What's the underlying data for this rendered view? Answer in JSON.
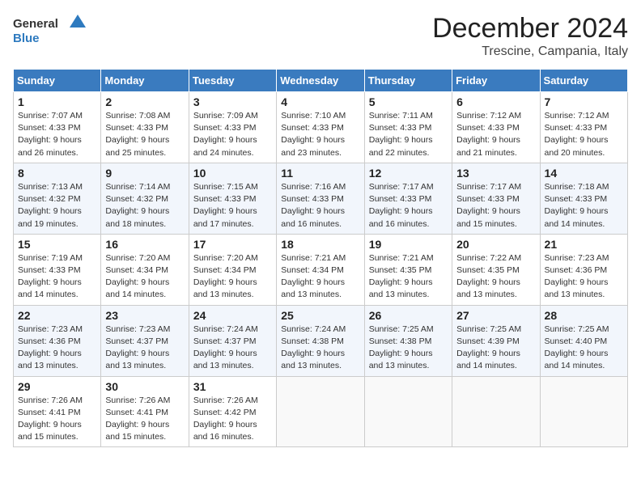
{
  "logo": {
    "text_general": "General",
    "text_blue": "Blue",
    "icon_color": "#2e7abf"
  },
  "header": {
    "month": "December 2024",
    "location": "Trescine, Campania, Italy"
  },
  "weekdays": [
    "Sunday",
    "Monday",
    "Tuesday",
    "Wednesday",
    "Thursday",
    "Friday",
    "Saturday"
  ],
  "weeks": [
    [
      {
        "day": "1",
        "sunrise": "7:07 AM",
        "sunset": "4:33 PM",
        "daylight": "9 hours and 26 minutes."
      },
      {
        "day": "2",
        "sunrise": "7:08 AM",
        "sunset": "4:33 PM",
        "daylight": "9 hours and 25 minutes."
      },
      {
        "day": "3",
        "sunrise": "7:09 AM",
        "sunset": "4:33 PM",
        "daylight": "9 hours and 24 minutes."
      },
      {
        "day": "4",
        "sunrise": "7:10 AM",
        "sunset": "4:33 PM",
        "daylight": "9 hours and 23 minutes."
      },
      {
        "day": "5",
        "sunrise": "7:11 AM",
        "sunset": "4:33 PM",
        "daylight": "9 hours and 22 minutes."
      },
      {
        "day": "6",
        "sunrise": "7:12 AM",
        "sunset": "4:33 PM",
        "daylight": "9 hours and 21 minutes."
      },
      {
        "day": "7",
        "sunrise": "7:12 AM",
        "sunset": "4:33 PM",
        "daylight": "9 hours and 20 minutes."
      }
    ],
    [
      {
        "day": "8",
        "sunrise": "7:13 AM",
        "sunset": "4:32 PM",
        "daylight": "9 hours and 19 minutes."
      },
      {
        "day": "9",
        "sunrise": "7:14 AM",
        "sunset": "4:32 PM",
        "daylight": "9 hours and 18 minutes."
      },
      {
        "day": "10",
        "sunrise": "7:15 AM",
        "sunset": "4:33 PM",
        "daylight": "9 hours and 17 minutes."
      },
      {
        "day": "11",
        "sunrise": "7:16 AM",
        "sunset": "4:33 PM",
        "daylight": "9 hours and 16 minutes."
      },
      {
        "day": "12",
        "sunrise": "7:17 AM",
        "sunset": "4:33 PM",
        "daylight": "9 hours and 16 minutes."
      },
      {
        "day": "13",
        "sunrise": "7:17 AM",
        "sunset": "4:33 PM",
        "daylight": "9 hours and 15 minutes."
      },
      {
        "day": "14",
        "sunrise": "7:18 AM",
        "sunset": "4:33 PM",
        "daylight": "9 hours and 14 minutes."
      }
    ],
    [
      {
        "day": "15",
        "sunrise": "7:19 AM",
        "sunset": "4:33 PM",
        "daylight": "9 hours and 14 minutes."
      },
      {
        "day": "16",
        "sunrise": "7:20 AM",
        "sunset": "4:34 PM",
        "daylight": "9 hours and 14 minutes."
      },
      {
        "day": "17",
        "sunrise": "7:20 AM",
        "sunset": "4:34 PM",
        "daylight": "9 hours and 13 minutes."
      },
      {
        "day": "18",
        "sunrise": "7:21 AM",
        "sunset": "4:34 PM",
        "daylight": "9 hours and 13 minutes."
      },
      {
        "day": "19",
        "sunrise": "7:21 AM",
        "sunset": "4:35 PM",
        "daylight": "9 hours and 13 minutes."
      },
      {
        "day": "20",
        "sunrise": "7:22 AM",
        "sunset": "4:35 PM",
        "daylight": "9 hours and 13 minutes."
      },
      {
        "day": "21",
        "sunrise": "7:23 AM",
        "sunset": "4:36 PM",
        "daylight": "9 hours and 13 minutes."
      }
    ],
    [
      {
        "day": "22",
        "sunrise": "7:23 AM",
        "sunset": "4:36 PM",
        "daylight": "9 hours and 13 minutes."
      },
      {
        "day": "23",
        "sunrise": "7:23 AM",
        "sunset": "4:37 PM",
        "daylight": "9 hours and 13 minutes."
      },
      {
        "day": "24",
        "sunrise": "7:24 AM",
        "sunset": "4:37 PM",
        "daylight": "9 hours and 13 minutes."
      },
      {
        "day": "25",
        "sunrise": "7:24 AM",
        "sunset": "4:38 PM",
        "daylight": "9 hours and 13 minutes."
      },
      {
        "day": "26",
        "sunrise": "7:25 AM",
        "sunset": "4:38 PM",
        "daylight": "9 hours and 13 minutes."
      },
      {
        "day": "27",
        "sunrise": "7:25 AM",
        "sunset": "4:39 PM",
        "daylight": "9 hours and 14 minutes."
      },
      {
        "day": "28",
        "sunrise": "7:25 AM",
        "sunset": "4:40 PM",
        "daylight": "9 hours and 14 minutes."
      }
    ],
    [
      {
        "day": "29",
        "sunrise": "7:26 AM",
        "sunset": "4:41 PM",
        "daylight": "9 hours and 15 minutes."
      },
      {
        "day": "30",
        "sunrise": "7:26 AM",
        "sunset": "4:41 PM",
        "daylight": "9 hours and 15 minutes."
      },
      {
        "day": "31",
        "sunrise": "7:26 AM",
        "sunset": "4:42 PM",
        "daylight": "9 hours and 16 minutes."
      },
      null,
      null,
      null,
      null
    ]
  ],
  "cell_labels": {
    "sunrise": "Sunrise:",
    "sunset": "Sunset:",
    "daylight": "Daylight:"
  }
}
